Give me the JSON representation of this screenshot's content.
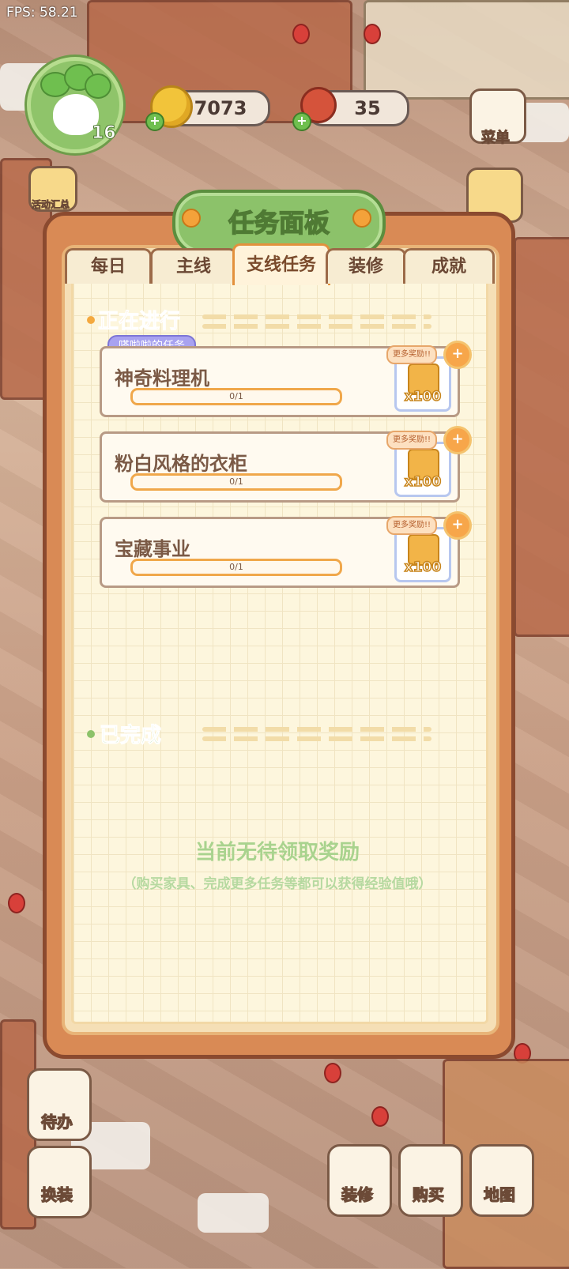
{
  "fps": "FPS: 58.21",
  "hud": {
    "level": "16",
    "coins": "7073",
    "meat": "35",
    "menu_label": "菜单",
    "activity_label": "活动汇总"
  },
  "panel": {
    "title": "任务面板",
    "tabs": [
      {
        "label": "每日"
      },
      {
        "label": "主线"
      },
      {
        "label": "支线任务"
      },
      {
        "label": "装修"
      },
      {
        "label": "成就"
      }
    ],
    "active_tab": "支线任务",
    "in_progress_title": "正在进行",
    "group_tag": "嗒啦啦的任务",
    "tasks": [
      {
        "name": "神奇料理机",
        "progress": "0/1",
        "fraction": 0,
        "more_reward": "更多奖励!!",
        "reward_qty": "x100"
      },
      {
        "name": "粉白风格的衣柜",
        "progress": "0/1",
        "fraction": 0,
        "more_reward": "更多奖励!!",
        "reward_qty": "x100"
      },
      {
        "name": "宝藏事业",
        "progress": "0/1",
        "fraction": 0,
        "more_reward": "更多奖励!!",
        "reward_qty": "x100"
      }
    ],
    "completed_title": "已完成",
    "empty_title": "当前无待领取奖励",
    "empty_subtitle": "（购买家具、完成更多任务等都可以获得经验值哦）"
  },
  "bottom": {
    "todo": "待办",
    "dressup": "换装",
    "decorate": "装修",
    "buy": "购买",
    "map": "地图"
  },
  "colors": {
    "accent": "#f4a93f",
    "panel": "#d98a55",
    "green": "#8cc26a"
  }
}
